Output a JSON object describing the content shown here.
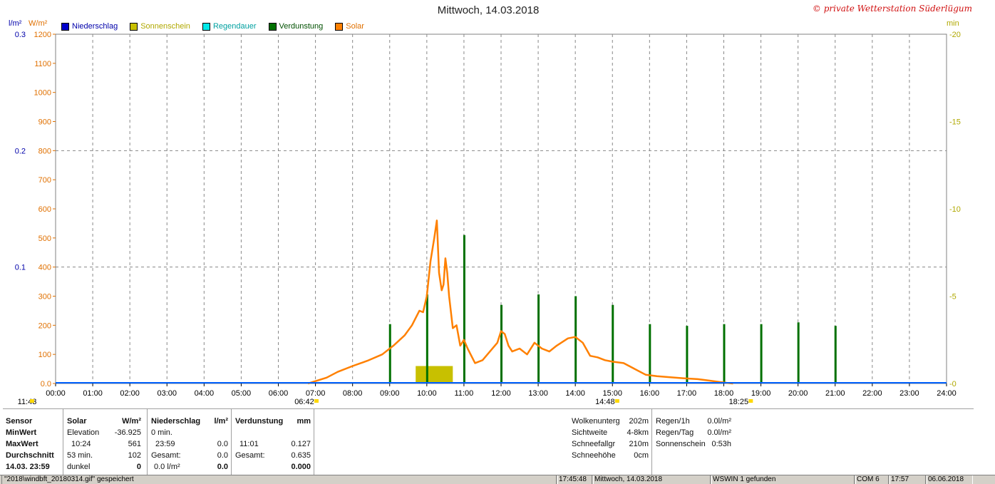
{
  "header": {
    "title": "Mittwoch, 14.03.2018",
    "copyright": "© private Wetterstation Süderlügum",
    "unit_left_1": "l/m²",
    "unit_left_2": "W/m²",
    "unit_right": "min"
  },
  "legend": [
    {
      "label": "Niederschlag",
      "color": "#0000cc",
      "text_color": "#0000aa"
    },
    {
      "label": "Sonnenschein",
      "color": "#c8c000",
      "text_color": "#b0a800"
    },
    {
      "label": "Regendauer",
      "color": "#00e8e8",
      "text_color": "#00a0a0"
    },
    {
      "label": "Verdunstung",
      "color": "#007000",
      "text_color": "#005000"
    },
    {
      "label": "Solar",
      "color": "#ff8000",
      "text_color": "#e07000"
    }
  ],
  "chart_data": {
    "type": "line",
    "title": "Mittwoch, 14.03.2018",
    "x_ticks": [
      "00:00",
      "01:00",
      "02:00",
      "03:00",
      "04:00",
      "05:00",
      "06:00",
      "07:00",
      "08:00",
      "09:00",
      "10:00",
      "11:00",
      "12:00",
      "13:00",
      "14:00",
      "15:00",
      "16:00",
      "17:00",
      "18:00",
      "19:00",
      "20:00",
      "21:00",
      "22:00",
      "23:00",
      "24:00"
    ],
    "xlim_hours": [
      0,
      24
    ],
    "y_solar": {
      "label": "W/m²",
      "ticks": [
        0,
        100,
        200,
        300,
        400,
        500,
        600,
        700,
        800,
        900,
        1000,
        1100,
        1200
      ],
      "lim": [
        0,
        1200
      ]
    },
    "y_rain": {
      "label": "l/m²",
      "ticks": [
        "0.0",
        "0.1",
        "0.2",
        "0.3"
      ],
      "lim": [
        0,
        0.3
      ]
    },
    "y_min": {
      "label": "min",
      "ticks": [
        "0",
        "5",
        "10",
        "15",
        "20"
      ],
      "lim": [
        0,
        20
      ]
    },
    "grid": true,
    "series": [
      {
        "name": "Solar",
        "color": "#ff8000",
        "x": [
          6.8,
          7.0,
          7.3,
          7.6,
          8.0,
          8.4,
          8.8,
          9.1,
          9.4,
          9.6,
          9.8,
          9.9,
          10.0,
          10.1,
          10.2,
          10.27,
          10.33,
          10.4,
          10.45,
          10.5,
          10.55,
          10.6,
          10.7,
          10.8,
          10.9,
          11.0,
          11.1,
          11.3,
          11.5,
          11.7,
          11.9,
          12.0,
          12.1,
          12.2,
          12.3,
          12.5,
          12.7,
          12.9,
          13.1,
          13.3,
          13.5,
          13.8,
          14.0,
          14.2,
          14.4,
          14.6,
          14.8,
          15.0,
          15.3,
          15.6,
          15.9,
          16.2,
          16.5,
          16.9,
          17.3,
          17.6,
          17.9,
          18.1,
          18.25
        ],
        "values": [
          0,
          8,
          20,
          40,
          60,
          78,
          100,
          130,
          165,
          200,
          250,
          245,
          300,
          420,
          500,
          560,
          380,
          320,
          340,
          430,
          380,
          300,
          190,
          200,
          130,
          150,
          120,
          70,
          80,
          110,
          140,
          180,
          170,
          130,
          110,
          120,
          100,
          140,
          120,
          110,
          130,
          155,
          160,
          140,
          95,
          90,
          80,
          75,
          70,
          50,
          30,
          25,
          22,
          18,
          15,
          10,
          5,
          2,
          0
        ]
      },
      {
        "name": "Verdunstung",
        "color": "#007000",
        "x": [
          9.0,
          10.0,
          11.0,
          12.0,
          13.0,
          14.0,
          15.0,
          16.0,
          17.0,
          18.0,
          19.0,
          20.0,
          21.0
        ],
        "values_min": [
          3.4,
          5.1,
          8.5,
          4.5,
          5.1,
          5.0,
          4.5,
          3.4,
          3.3,
          3.4,
          3.4,
          3.5,
          3.3
        ]
      },
      {
        "name": "Sonnenschein",
        "color": "#c8c000",
        "x_start": 9.7,
        "x_end": 10.7,
        "value_min": 1.0
      }
    ],
    "markers": [
      {
        "label": "11:43",
        "hour": -0.7
      },
      {
        "label": "06:42",
        "hour": 6.7
      },
      {
        "label": "14:48",
        "hour": 14.8
      },
      {
        "label": "18:25",
        "hour": 18.4
      }
    ]
  },
  "stats": {
    "sensor": {
      "header": "Sensor",
      "rows": [
        "MinWert",
        "MaxWert",
        "Durchschnitt",
        "14.03. 23:59"
      ]
    },
    "solar": {
      "header": "Solar",
      "unit": "W/m²",
      "rows": [
        [
          "Elevation",
          "-36.925"
        ],
        [
          "10:24",
          "561"
        ],
        [
          "53 min.",
          "102"
        ],
        [
          "dunkel",
          "0"
        ]
      ]
    },
    "niederschlag": {
      "header": "Niederschlag",
      "unit": "l/m²",
      "rows": [
        [
          "0 min.",
          ""
        ],
        [
          "23:59",
          "0.0"
        ],
        [
          "Gesamt:",
          "0.0"
        ],
        [
          "0.0 l/m²",
          "0.0"
        ]
      ]
    },
    "verdunstung": {
      "header": "Verdunstung",
      "unit": "mm",
      "rows": [
        [
          "",
          ""
        ],
        [
          "11:01",
          "0.127"
        ],
        [
          "Gesamt:",
          "0.635"
        ],
        [
          "",
          "0.000"
        ]
      ]
    },
    "wolken": [
      [
        "Wolkenunterg",
        "202m"
      ],
      [
        "Sichtweite",
        "4-8km"
      ],
      [
        "Schneefallgr",
        "210m"
      ],
      [
        "Schneehöhe",
        "0cm"
      ]
    ],
    "regen": [
      [
        "Regen/1h",
        "0.0l/m²"
      ],
      [
        "Regen/Tag",
        "0.0l/m²"
      ],
      [
        "Sonnenschein",
        "0:53h"
      ]
    ]
  },
  "statusbar": [
    "\"2018\\windbft_20180314.gif\" gespeichert",
    "17:45:48",
    "Mittwoch, 14.03.2018",
    "WSWIN 1 gefunden",
    "COM 6",
    "17:57",
    "06.06.2018"
  ]
}
